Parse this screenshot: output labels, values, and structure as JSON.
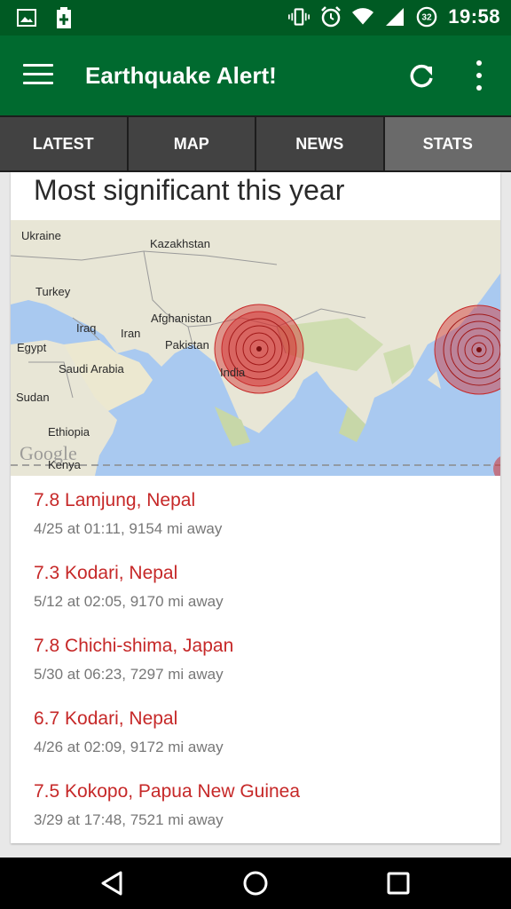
{
  "status_bar": {
    "time": "19:58",
    "battery_level": "32",
    "icons": [
      "image-icon",
      "battery-saver-icon",
      "vibrate-icon",
      "alarm-icon",
      "wifi-icon",
      "signal-icon",
      "battery-icon"
    ]
  },
  "app_bar": {
    "title": "Earthquake Alert!",
    "icons": [
      "menu-icon",
      "refresh-icon",
      "overflow-icon"
    ],
    "color": "#006a2f"
  },
  "tabs": [
    {
      "label": "LATEST"
    },
    {
      "label": "MAP"
    },
    {
      "label": "NEWS"
    },
    {
      "label": "STATS",
      "selected": true
    }
  ],
  "section": {
    "title": "Most significant this year"
  },
  "map": {
    "labels": {
      "ukraine": "Ukraine",
      "kazakhstan": "Kazakhstan",
      "turkey": "Turkey",
      "afghanistan": "Afghanistan",
      "iraq": "Iraq",
      "iran": "Iran",
      "pakistan": "Pakistan",
      "egypt": "Egypt",
      "saudi_arabia": "Saudi Arabia",
      "india": "India",
      "sudan": "Sudan",
      "ethiopia": "Ethiopia",
      "kenya": "Kenya"
    },
    "watermark": "Google"
  },
  "quakes": [
    {
      "title": "7.8 Lamjung, Nepal",
      "meta": "4/25 at 01:11, 9154 mi away"
    },
    {
      "title": "7.3 Kodari, Nepal",
      "meta": "5/12 at 02:05, 9170 mi away"
    },
    {
      "title": "7.8 Chichi-shima, Japan",
      "meta": "5/30 at 06:23, 7297 mi away"
    },
    {
      "title": "6.7 Kodari, Nepal",
      "meta": "4/26 at 02:09, 9172 mi away"
    },
    {
      "title": "7.5 Kokopo, Papua New Guinea",
      "meta": "3/29 at 17:48, 7521 mi away"
    }
  ],
  "nav": {
    "icons": [
      "back-icon",
      "home-icon",
      "recents-icon"
    ]
  }
}
